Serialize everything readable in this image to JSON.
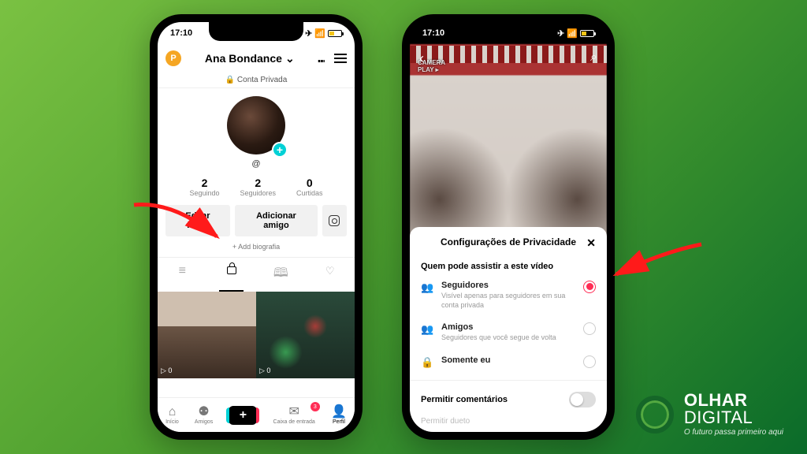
{
  "status": {
    "time": "17:10",
    "airplane": "✈",
    "wifi": "📶"
  },
  "left": {
    "header": {
      "initial": "P",
      "name": "Ana Bondance",
      "live_icon": "⑉"
    },
    "private": "🔒 Conta Privada",
    "username": "@",
    "stats": {
      "following": {
        "num": "2",
        "label": "Seguindo"
      },
      "followers": {
        "num": "2",
        "label": "Seguidores"
      },
      "likes": {
        "num": "0",
        "label": "Curtidas"
      }
    },
    "buttons": {
      "edit": "Editar Perfil",
      "add_friend": "Adicionar amigo"
    },
    "add_bio": "+ Add biografia",
    "thumbs": {
      "v1": "▷ 0",
      "v2": "▷ 0"
    },
    "nav": {
      "home": "Início",
      "friends": "Amigos",
      "inbox": "Caixa de entrada",
      "inbox_badge": "3",
      "profile": "Perfil"
    }
  },
  "right": {
    "watermark1": "CAMERA",
    "watermark2": "PLAY ▸",
    "sheet_title": "Configurações de Privacidade",
    "section": "Quem pode assistir a este vídeo",
    "opt1": {
      "label": "Seguidores",
      "sub": "Visível apenas para seguidores em sua conta privada"
    },
    "opt2": {
      "label": "Amigos",
      "sub": "Seguidores que você segue de volta"
    },
    "opt3": {
      "label": "Somente eu"
    },
    "allow_comments": "Permitir comentários",
    "allow_duet": "Permitir dueto"
  },
  "logo": {
    "brand1": "OLHAR",
    "brand2": "DIGITAL",
    "tag": "O futuro passa primeiro aqui"
  }
}
